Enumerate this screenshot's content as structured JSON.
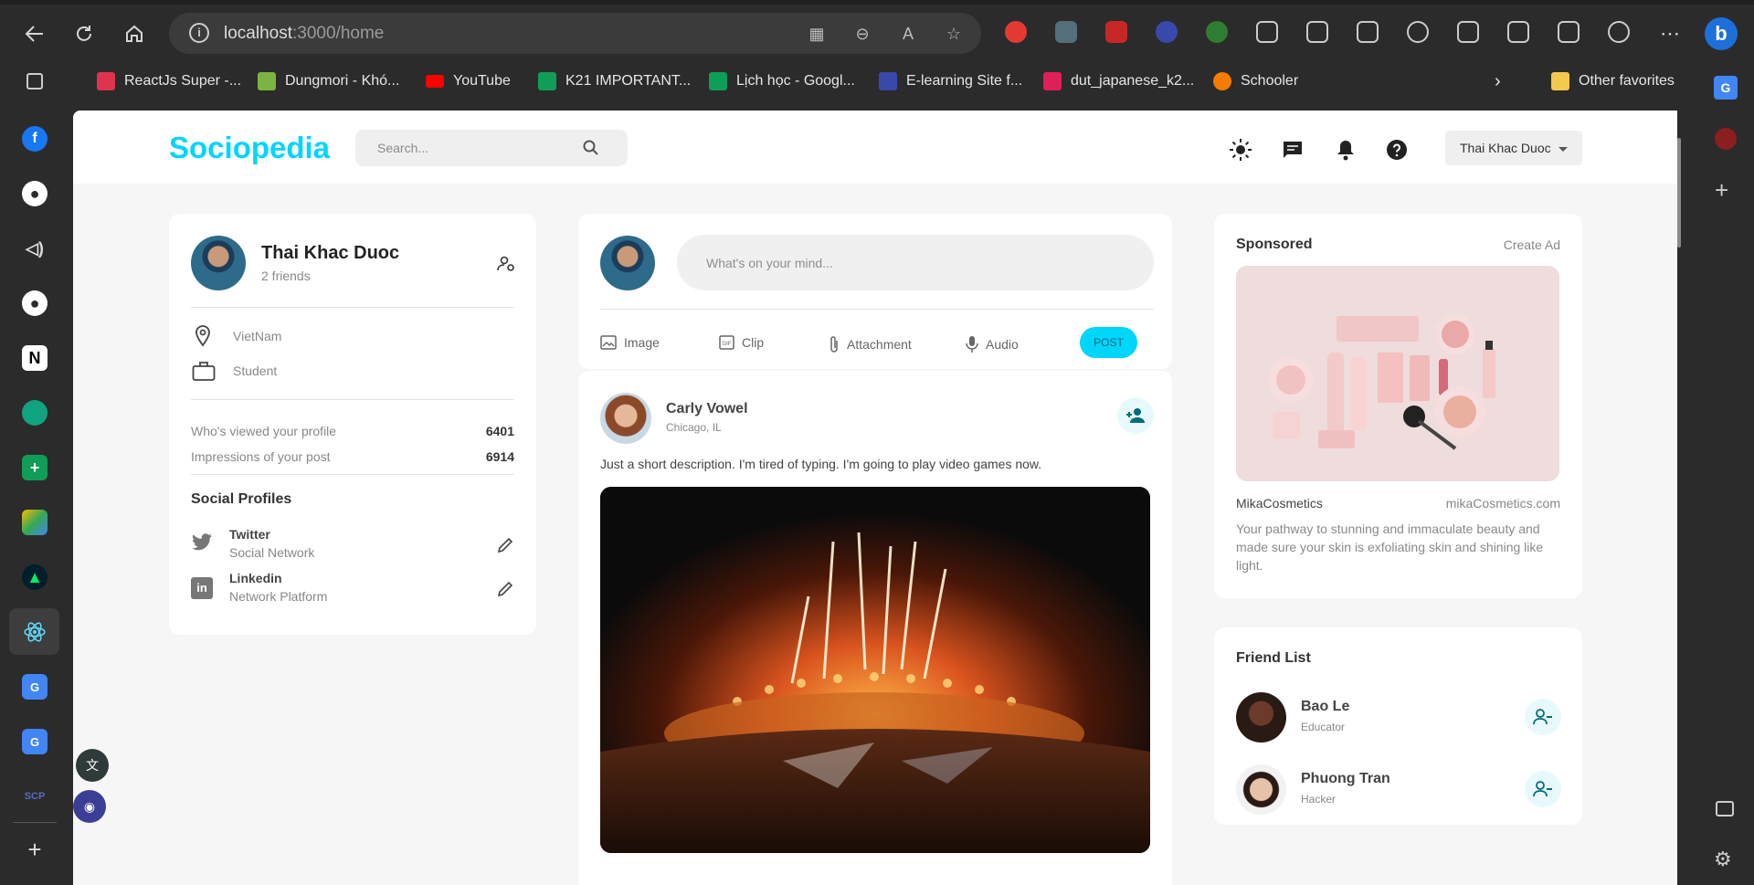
{
  "browser": {
    "url_host": "localhost",
    "url_path": ":3000/home",
    "bookmarks": [
      {
        "label": "ReactJs Super -...",
        "color": "#e0334f"
      },
      {
        "label": "Dungmori - Khó...",
        "color": "#7cb342"
      },
      {
        "label": "YouTube",
        "color": "#ff0000"
      },
      {
        "label": "K21 IMPORTANT...",
        "color": "#0f9d58"
      },
      {
        "label": "Lịch học - Googl...",
        "color": "#0f9d58"
      },
      {
        "label": "E-learning Site f...",
        "color": "#3949ab"
      },
      {
        "label": "dut_japanese_k2...",
        "color": "#e01e5a"
      },
      {
        "label": "Schooler",
        "color": "#f57c00"
      }
    ],
    "other_favorites": "Other favorites"
  },
  "app": {
    "logo": "Sociopedia",
    "search_placeholder": "Search...",
    "user_name": "Thai Khac Duoc",
    "accent": "#00d5fa"
  },
  "profile": {
    "name": "Thai Khac Duoc",
    "friends": "2 friends",
    "location": "VietNam",
    "occupation": "Student",
    "stats": [
      {
        "label": "Who's viewed your profile",
        "value": "6401"
      },
      {
        "label": "Impressions of your post",
        "value": "6914"
      }
    ],
    "social_title": "Social Profiles",
    "socials": [
      {
        "name": "Twitter",
        "type": "Social Network"
      },
      {
        "name": "Linkedin",
        "type": "Network Platform"
      }
    ]
  },
  "composer": {
    "placeholder": "What's on your mind...",
    "actions": [
      "Image",
      "Clip",
      "Attachment",
      "Audio"
    ],
    "post_label": "POST"
  },
  "post": {
    "author": "Carly Vowel",
    "location": "Chicago, IL",
    "description": "Just a short description. I'm tired of typing. I'm going to play video games now."
  },
  "sponsored": {
    "title": "Sponsored",
    "create_ad": "Create Ad",
    "brand": "MikaCosmetics",
    "site": "mikaCosmetics.com",
    "text": "Your pathway to stunning and immaculate beauty and made sure your skin is exfoliating skin and shining like light."
  },
  "friends": {
    "title": "Friend List",
    "list": [
      {
        "name": "Bao Le",
        "role": "Educator"
      },
      {
        "name": "Phuong Tran",
        "role": "Hacker"
      }
    ]
  }
}
